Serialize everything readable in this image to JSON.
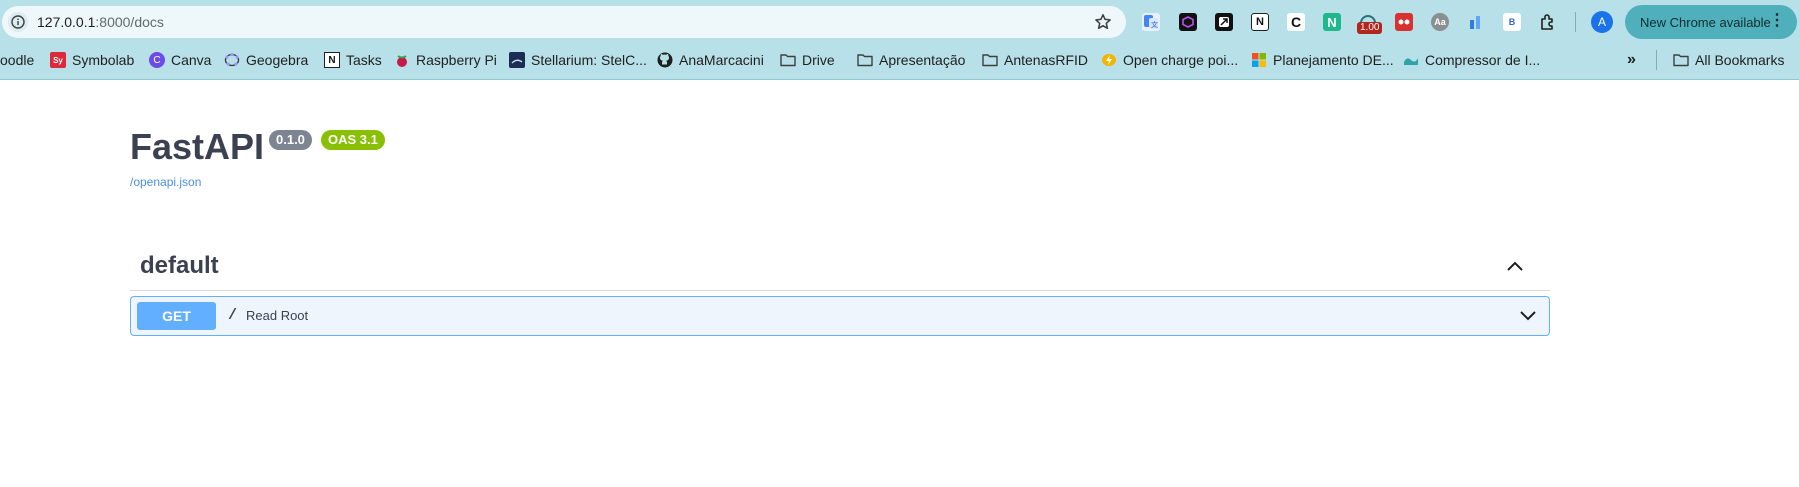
{
  "browser": {
    "url_host": "127.0.0.1",
    "url_rest": ":8000/docs",
    "update_label": "New Chrome available",
    "profile_initial": "A",
    "ext_badge": "1.00",
    "bookmarks": [
      {
        "label": "oodle",
        "icon": "moodle-icon"
      },
      {
        "label": "Symbolab",
        "icon": "symbolab-icon",
        "mark": "Sy"
      },
      {
        "label": "Canva",
        "icon": "canva-icon",
        "mark": "C"
      },
      {
        "label": "Geogebra",
        "icon": "geogebra-icon"
      },
      {
        "label": "Tasks",
        "icon": "notion-icon",
        "mark": "N"
      },
      {
        "label": "Raspberry Pi",
        "icon": "raspberry-icon"
      },
      {
        "label": "Stellarium: StelC...",
        "icon": "stellarium-icon"
      },
      {
        "label": "AnaMarcacini",
        "icon": "github-icon"
      },
      {
        "label": "Drive",
        "icon": "folder-icon"
      },
      {
        "label": "Apresentação",
        "icon": "folder-icon"
      },
      {
        "label": "AntenasRFID",
        "icon": "folder-icon"
      },
      {
        "label": "Open charge poi...",
        "icon": "openchargemap-icon"
      },
      {
        "label": "Planejamento DE...",
        "icon": "microsoft-icon"
      },
      {
        "label": "Compressor de I...",
        "icon": "compressor-icon"
      }
    ],
    "all_bookmarks": "All Bookmarks"
  },
  "api": {
    "title": "FastAPI",
    "version": "0.1.0",
    "oas": "OAS 3.1",
    "spec_link": "/openapi.json",
    "tag": "default",
    "operations": [
      {
        "method": "GET",
        "path": "/",
        "summary": "Read Root"
      }
    ]
  },
  "colors": {
    "get_blue": "#61affe",
    "oas_green": "#89bf04",
    "version_gray": "#7d8492",
    "text_dark": "#3b4151"
  }
}
